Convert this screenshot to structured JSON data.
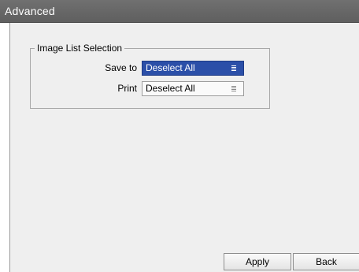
{
  "window": {
    "title": "Advanced"
  },
  "image_list_selection": {
    "group_title": "Image List Selection",
    "save_to": {
      "label": "Save to",
      "value": "Deselect All"
    },
    "print": {
      "label": "Print",
      "value": "Deselect All"
    }
  },
  "footer": {
    "apply_label": "Apply",
    "back_label": "Back"
  },
  "icons": {
    "dropdown": "list-dropdown-icon"
  },
  "colors": {
    "titlebar": "#666666",
    "active_select": "#2b4fa8",
    "panel": "#efefef"
  }
}
